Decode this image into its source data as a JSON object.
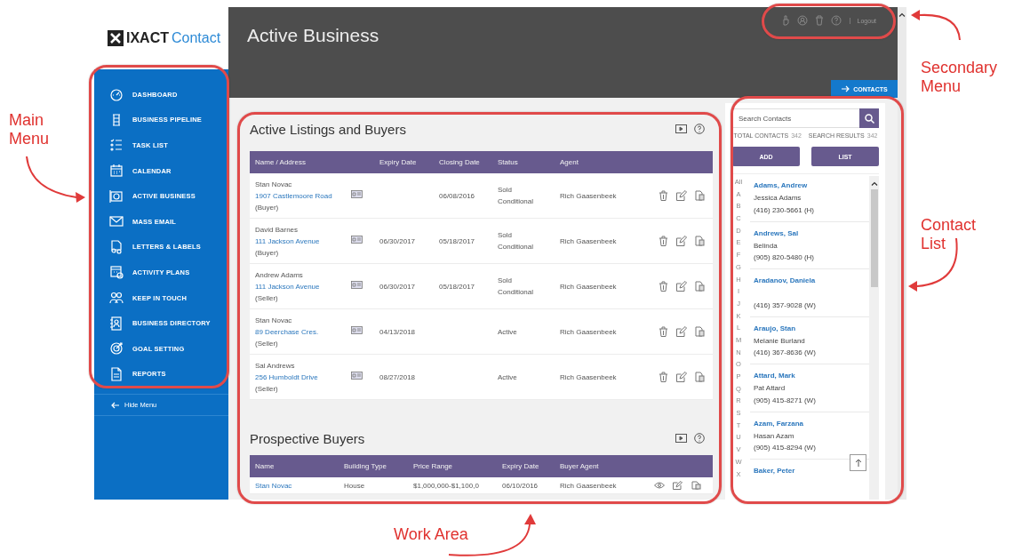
{
  "sidebar": {
    "logo": {
      "word_1": "IXACT",
      "word_2": "Contact"
    },
    "items": [
      {
        "label": "DASHBOARD"
      },
      {
        "label": "BUSINESS PIPELINE"
      },
      {
        "label": "TASK LIST"
      },
      {
        "label": "CALENDAR"
      },
      {
        "label": "ACTIVE BUSINESS"
      },
      {
        "label": "MASS EMAIL"
      },
      {
        "label": "LETTERS & LABELS"
      },
      {
        "label": "ACTIVITY PLANS"
      },
      {
        "label": "KEEP IN TOUCH"
      },
      {
        "label": "BUSINESS DIRECTORY"
      },
      {
        "label": "GOAL SETTING"
      },
      {
        "label": "REPORTS"
      }
    ],
    "hide_menu": "Hide Menu"
  },
  "header": {
    "title": "Active Business",
    "secondary_menu": {
      "logout": "Logout"
    },
    "contacts_tab": "CONTACTS"
  },
  "active_listings": {
    "title": "Active Listings and Buyers",
    "columns": [
      "Name / Address",
      "Expiry Date",
      "Closing Date",
      "Status",
      "Agent"
    ],
    "rows": [
      {
        "name": "Stan Novac",
        "address": "1907 Castlemoore Road",
        "role": "(Buyer)",
        "expiry": "",
        "closing": "06/08/2016",
        "status": "Sold Conditional",
        "agent": "Rich Gaasenbeek"
      },
      {
        "name": "David Barnes",
        "address": "111 Jackson Avenue",
        "role": "(Buyer)",
        "expiry": "06/30/2017",
        "closing": "05/18/2017",
        "status": "Sold Conditional",
        "agent": "Rich Gaasenbeek"
      },
      {
        "name": "Andrew Adams",
        "address": "111 Jackson Avenue",
        "role": "(Seller)",
        "expiry": "06/30/2017",
        "closing": "05/18/2017",
        "status": "Sold Conditional",
        "agent": "Rich Gaasenbeek"
      },
      {
        "name": "Stan Novac",
        "address": "89 Deerchase Cres.",
        "role": "(Seller)",
        "expiry": "04/13/2018",
        "closing": "",
        "status": "Active",
        "agent": "Rich Gaasenbeek"
      },
      {
        "name": "Sal Andrews",
        "address": "256 Humboldt Drive",
        "role": "(Seller)",
        "expiry": "08/27/2018",
        "closing": "",
        "status": "Active",
        "agent": "Rich Gaasenbeek"
      }
    ]
  },
  "prospective_buyers": {
    "title": "Prospective Buyers",
    "columns": [
      "Name",
      "Building Type",
      "Price Range",
      "Expiry Date",
      "Buyer Agent"
    ],
    "rows": [
      {
        "name": "Stan Novac",
        "building_type": "House",
        "price_range": "$1,000,000-$1,100,0",
        "expiry": "06/10/2016",
        "agent": "Rich Gaasenbeek"
      }
    ]
  },
  "contacts": {
    "search": {
      "placeholder": "Search Contacts"
    },
    "total_label": "TOTAL CONTACTS",
    "total": "342",
    "results_label": "SEARCH RESULTS",
    "results": "342",
    "buttons": [
      "ADD",
      "LIST"
    ],
    "letters": [
      "All",
      "A",
      "B",
      "C",
      "D",
      "E",
      "F",
      "G",
      "H",
      "I",
      "J",
      "K",
      "L",
      "M",
      "N",
      "O",
      "P",
      "Q",
      "R",
      "S",
      "T",
      "U",
      "V",
      "W",
      "X"
    ],
    "list": [
      {
        "name": "Adams, Andrew",
        "secondary": "Jessica Adams",
        "phone": "(416) 230-5661 (H)"
      },
      {
        "name": "Andrews, Sal",
        "secondary": "Belinda",
        "phone": "(905) 820-5480 (H)"
      },
      {
        "name": "Aradanov, Daniela",
        "phone": "(416) 357-9028 (W)"
      },
      {
        "name": "Araujo, Stan",
        "secondary": "Melanie Burland",
        "phone": "(416) 367-8636 (W)"
      },
      {
        "name": "Attard, Mark",
        "secondary": "Pat Attard",
        "phone": "(905) 415-8271 (W)"
      },
      {
        "name": "Azam, Farzana",
        "secondary": "Hasan Azam",
        "phone": "(905) 415-8294 (W)"
      },
      {
        "name": "Baker, Peter"
      }
    ]
  },
  "annotations": [
    {
      "label": "Main Menu"
    },
    {
      "label": "Secondary Menu"
    },
    {
      "label": "Contact List"
    },
    {
      "label": "Work Area"
    }
  ]
}
